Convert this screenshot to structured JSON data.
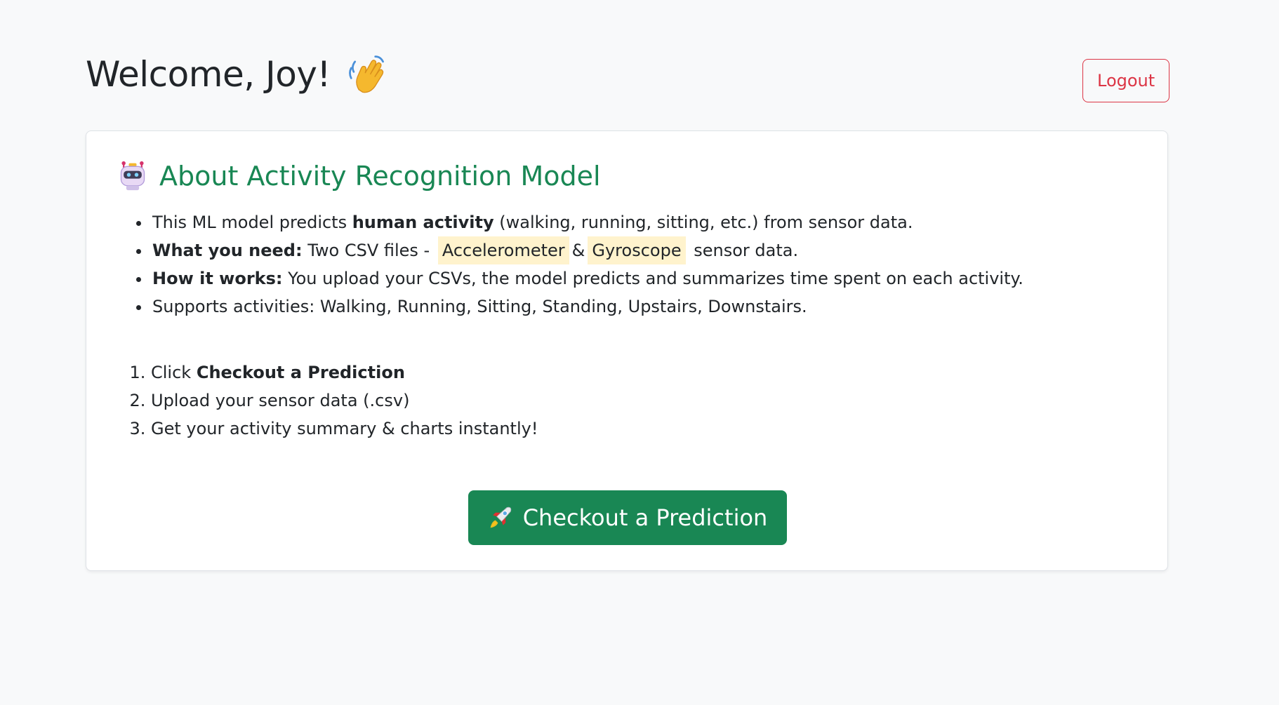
{
  "header": {
    "welcome_text": "Welcome, Joy!",
    "wave_icon": "waving-hand-icon",
    "logout_label": "Logout"
  },
  "card": {
    "icon": "robot-icon",
    "title": "About Activity Recognition Model",
    "features": {
      "item1": {
        "pre": "This ML model predicts ",
        "bold": "human activity",
        "post": " (walking, running, sitting, etc.) from sensor data."
      },
      "item2": {
        "bold": "What you need:",
        "pre": " Two CSV files - ",
        "tag1": "Accelerometer",
        "mid": "&",
        "tag2": "Gyroscope",
        "post": " sensor data."
      },
      "item3": {
        "bold": "How it works:",
        "post": " You upload your CSVs, the model predicts and summarizes time spent on each activity."
      },
      "item4": {
        "text": "Supports activities: Walking, Running, Sitting, Standing, Upstairs, Downstairs."
      }
    },
    "steps": {
      "step1": {
        "pre": "Click ",
        "bold": "Checkout a Prediction"
      },
      "step2": {
        "text": "Upload your sensor data (.csv)"
      },
      "step3": {
        "text": "Get your activity summary & charts instantly!"
      }
    },
    "cta_icon": "rocket-icon",
    "cta_label": "Checkout a Prediction"
  },
  "colors": {
    "background": "#f8f9fa",
    "accent_green": "#198754",
    "danger_red": "#dc3545",
    "highlight": "#fff3cd"
  }
}
